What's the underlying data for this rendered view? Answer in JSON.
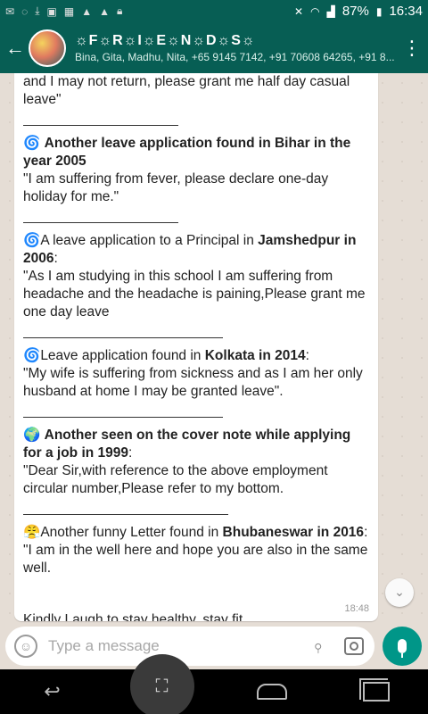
{
  "status_bar": {
    "left_icons": [
      "email-icon",
      "whatsapp-icon",
      "download-icon",
      "image-icon",
      "gallery-icon",
      "warning-icon",
      "warning-icon",
      "lock-icon"
    ],
    "battery": "87%",
    "time": "16:34"
  },
  "header": {
    "title": "☼F☼R☼I☼E☼N☼D☼S☼",
    "subtitle": "Bina, Gita, Madhu, Nita, +65 9145 7142, +91 70608 64265, +91 8..."
  },
  "message": {
    "p1": "and I may not return, please grant me half day casual leave\"",
    "p2_emoji": "🌀",
    "p2_title": "Another leave application found in Bihar in the year 2005",
    "p2_body": "\"I am suffering from fever, please declare one-day holiday for me.\"",
    "p3_emoji": "🌀",
    "p3_pre": "A leave application to a Principal in ",
    "p3_bold": "Jamshedpur in 2006",
    "p3_colon": ":",
    "p3_body": "\"As I am studying in this school I am suffering from headache and the headache is paining,Please grant me one day leave",
    "p4_emoji": "🌀",
    "p4_pre": "Leave application found in ",
    "p4_bold": "Kolkata in 2014",
    "p4_colon": ":",
    "p4_body": "\"My wife is suffering from sickness and as I am her only husband at home I may be granted leave\".",
    "p5_emoji": "🌍",
    "p5_title": "Another seen on the cover note while applying for a job in 1999",
    "p5_colon": ":",
    "p5_body": "\"Dear Sir,with reference to the above employment circular number,Please refer to my bottom.",
    "p6_emoji": "😤",
    "p6_pre": "Another funny Letter found in ",
    "p6_bold": "Bhubaneswar in 2016",
    "p6_colon": ":",
    "p6_body": "\"I am in the well here and hope you are also in the same well.",
    "closing": "Kindly Laugh to stay healthy, stay fit..",
    "time": "18:48"
  },
  "composer": {
    "placeholder": "Type a message"
  },
  "colors": {
    "header": "#075e54",
    "mic": "#009688",
    "chat_bg": "#e5ddd5"
  }
}
